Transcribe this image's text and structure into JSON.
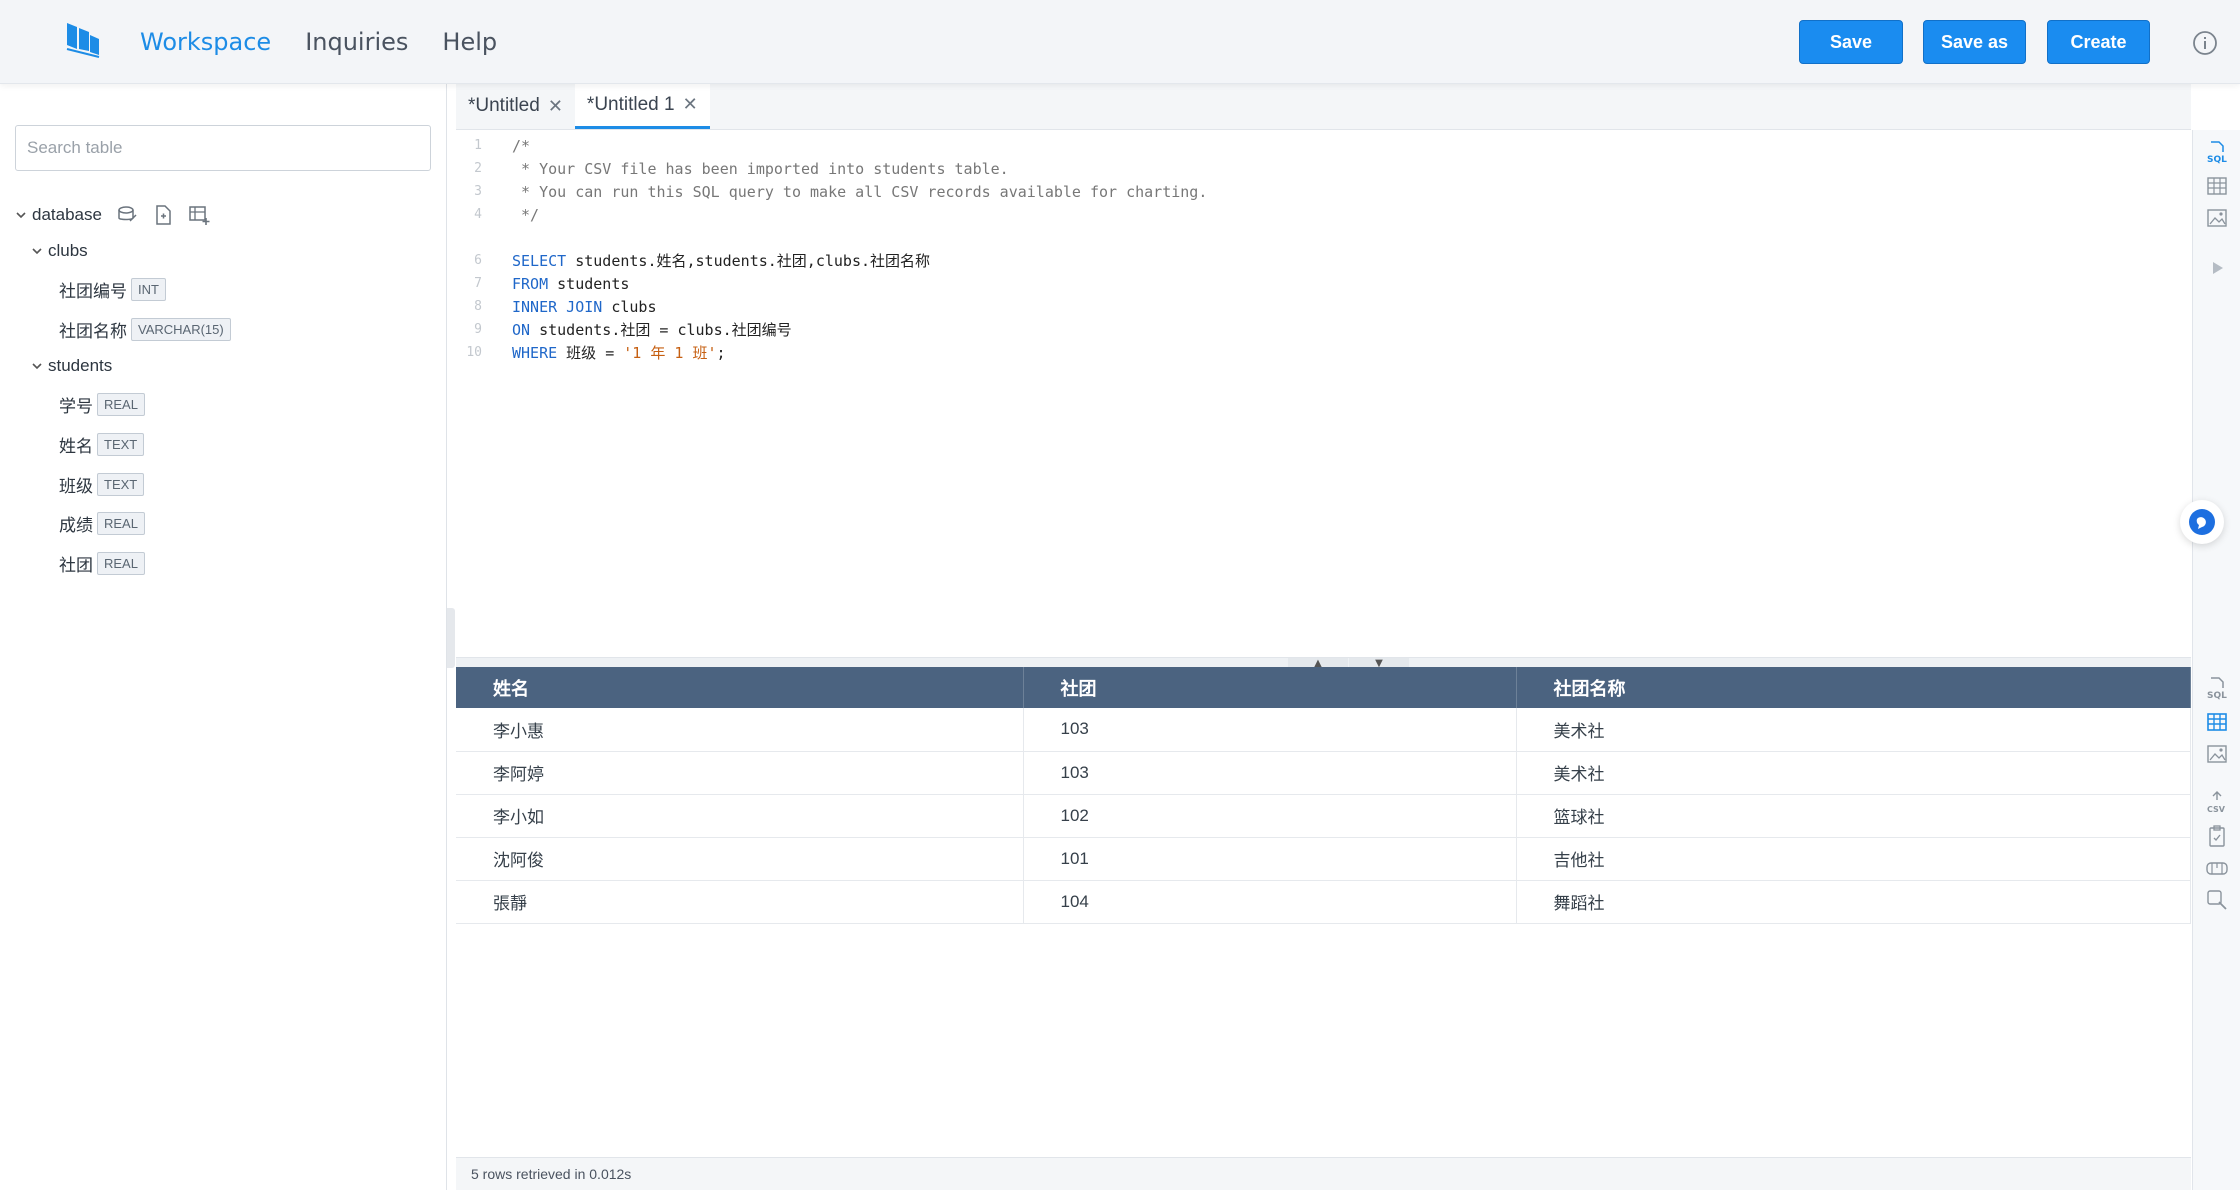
{
  "header": {
    "nav": [
      {
        "label": "Workspace",
        "active": true
      },
      {
        "label": "Inquiries",
        "active": false
      },
      {
        "label": "Help",
        "active": false
      }
    ],
    "buttons": {
      "save": "Save",
      "save_as": "Save as",
      "create": "Create"
    },
    "accent": "#1a8cf0"
  },
  "sidebar": {
    "search_placeholder": "Search table",
    "database_label": "database",
    "tables": [
      {
        "name": "clubs",
        "columns": [
          {
            "name": "社团编号",
            "type": "INT"
          },
          {
            "name": "社团名称",
            "type": "VARCHAR(15)"
          }
        ]
      },
      {
        "name": "students",
        "columns": [
          {
            "name": "学号",
            "type": "REAL"
          },
          {
            "name": "姓名",
            "type": "TEXT"
          },
          {
            "name": "班级",
            "type": "TEXT"
          },
          {
            "name": "成绩",
            "type": "REAL"
          },
          {
            "name": "社团",
            "type": "REAL"
          }
        ]
      }
    ]
  },
  "tabs": [
    {
      "label": "*Untitled",
      "active": false
    },
    {
      "label": "*Untitled 1",
      "active": true
    }
  ],
  "editor": {
    "line_numbers": [
      "1",
      "2",
      "3",
      "4",
      "",
      "6",
      "7",
      "8",
      "9",
      "10"
    ],
    "comment_lines": [
      "/*",
      " * Your CSV file has been imported into students table.",
      " * You can run this SQL query to make all CSV records available for charting.",
      " */"
    ],
    "kw": {
      "select": "SELECT",
      "from": "FROM",
      "inner_join": "INNER JOIN",
      "on": "ON",
      "where": "WHERE"
    },
    "select_rest": " students.姓名,students.社团,clubs.社团名称",
    "from_rest": " students",
    "join_rest": " clubs",
    "on_rest": " students.社团 = clubs.社团编号",
    "where_rest": " 班级 = ",
    "where_string": "'1 年 1 班'",
    "where_end": ";"
  },
  "results": {
    "headers": [
      "姓名",
      "社团",
      "社团名称"
    ],
    "rows": [
      [
        "李小惠",
        "103",
        "美术社"
      ],
      [
        "李阿婷",
        "103",
        "美术社"
      ],
      [
        "李小如",
        "102",
        "篮球社"
      ],
      [
        "沈阿俊",
        "101",
        "吉他社"
      ],
      [
        "張靜",
        "104",
        "舞蹈社"
      ]
    ],
    "status": "5 rows retrieved in 0.012s",
    "header_color": "#4b6380"
  },
  "icons": {
    "right_toolbar_top": [
      "sql-icon",
      "table-icon",
      "image-icon",
      "play-icon"
    ],
    "right_toolbar_bottom": [
      "sql-icon",
      "table-icon",
      "image-icon",
      "csv-export-icon",
      "clipboard-icon",
      "vr-icon",
      "search-icon"
    ]
  }
}
